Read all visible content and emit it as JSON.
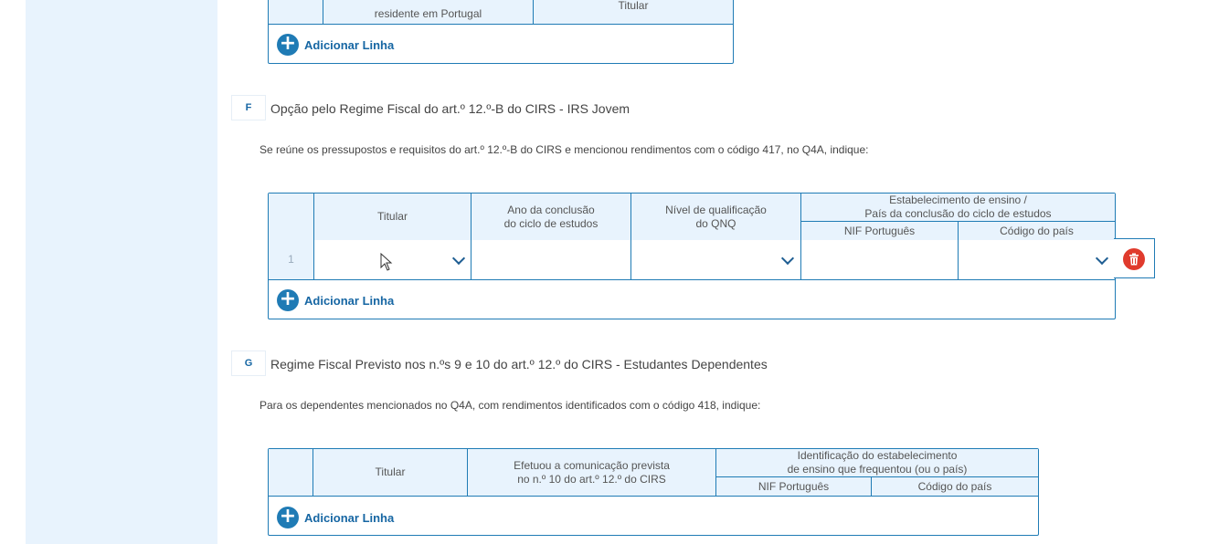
{
  "section_e": {
    "header_partial_1": "residente em Portugal",
    "header_partial_2": "Titular",
    "add_row_label": "Adicionar Linha"
  },
  "section_f": {
    "letter": "F",
    "title": "Opção pelo Regime Fiscal do art.º 12.º-B do CIRS - IRS Jovem",
    "note": "Se reúne os pressupostos e requisitos do art.º 12.º-B do CIRS e mencionou rendimentos com o código 417, no Q4A, indique:",
    "headers": {
      "titular": "Titular",
      "ano_l1": "Ano da conclusão",
      "ano_l2": "do ciclo de estudos",
      "nivel_l1": "Nível de qualificação",
      "nivel_l2": "do QNQ",
      "estab_l1": "Estabelecimento de ensino /",
      "estab_l2": "País da conclusão do ciclo de estudos",
      "nif": "NIF Português",
      "codigo": "Código do país"
    },
    "rows": [
      {
        "num": "1",
        "titular": "",
        "ano": "",
        "nivel": "",
        "nif": "",
        "codigo": ""
      }
    ],
    "add_row_label": "Adicionar Linha"
  },
  "section_g": {
    "letter": "G",
    "title": "Regime Fiscal Previsto nos n.ºs 9 e 10 do art.º 12.º do CIRS - Estudantes Dependentes",
    "note": "Para os dependentes mencionados no Q4A, com rendimentos identificados com o código 418, indique:",
    "headers": {
      "titular": "Titular",
      "efetuou_l1": "Efetuou a comunicação prevista",
      "efetuou_l2": "no n.º 10 do art.º 12.º do CIRS",
      "ident_l1": "Identificação do estabelecimento",
      "ident_l2": "de ensino que frequentou (ou o país)",
      "nif": "NIF Português",
      "codigo": "Código do país"
    },
    "add_row_label": "Adicionar Linha"
  },
  "icons": {
    "add": "plus-circle-icon",
    "dropdown": "chevron-down-icon",
    "delete": "trash-icon",
    "cursor": "mouse-pointer-icon"
  },
  "colors": {
    "accent": "#1f7bb5",
    "header_bg": "#e8f3fd",
    "sidebar_bg": "#e8f3fd",
    "delete": "#e03b2d"
  }
}
